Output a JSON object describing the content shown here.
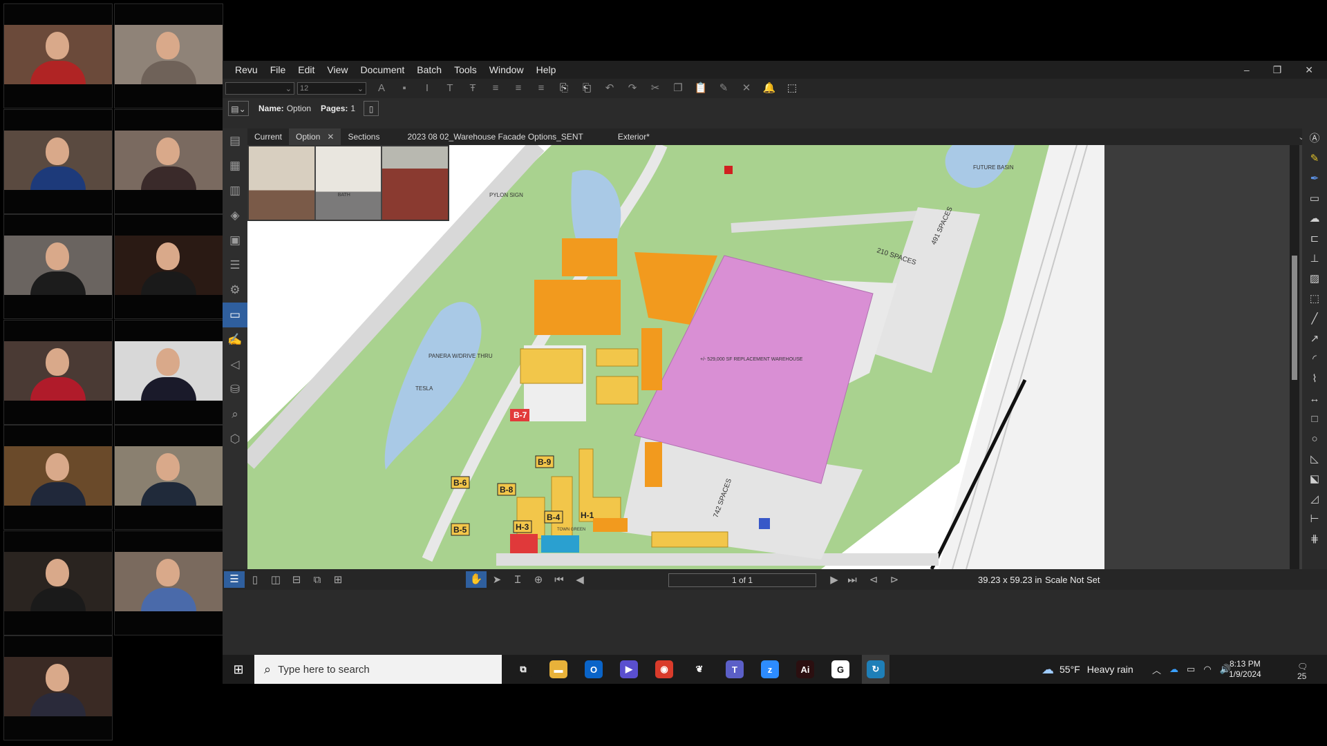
{
  "gallery": {
    "tiles": [
      {
        "bg": "#6b4a3a",
        "shirt": "#b02424"
      },
      {
        "bg": "#8f8378",
        "shirt": "#6f6259"
      },
      {
        "bg": "#5a4a40",
        "shirt": "#1d3a7a"
      },
      {
        "bg": "#7a6a60",
        "shirt": "#3a2a2a"
      },
      {
        "bg": "#6a6460",
        "shirt": "#1c1c1c"
      },
      {
        "bg": "#2a1a14",
        "shirt": "#1a1a1a"
      },
      {
        "bg": "#4a3a34",
        "shirt": "#b01b2a"
      },
      {
        "bg": "#d8d8d8",
        "shirt": "#1a1a2a"
      },
      {
        "bg": "#6a4a2a",
        "shirt": "#20283a"
      },
      {
        "bg": "#8a8070",
        "shirt": "#202a3a"
      },
      {
        "bg": "#2a2420",
        "shirt": "#1a1a1a"
      },
      {
        "bg": "#7a6a5e",
        "shirt": "#4a6aaa"
      },
      {
        "bg": "#3a2a24",
        "shirt": "#2a2a3a"
      }
    ]
  },
  "menu": {
    "items": [
      "Revu",
      "File",
      "Edit",
      "View",
      "Document",
      "Batch",
      "Tools",
      "Window",
      "Help"
    ],
    "window_controls": [
      "–",
      "❐",
      "✕"
    ]
  },
  "toolbar": {
    "font_name": "",
    "font_size": "12",
    "icons": [
      "font-color-icon",
      "trash-icon",
      "italic-icon",
      "text-icon",
      "text-strike-icon",
      "align-left-icon",
      "align-center-icon",
      "align-right-icon",
      "insert-page-icon",
      "extract-page-icon",
      "undo-icon",
      "redo-icon",
      "cut-icon",
      "copy-icon",
      "paste-icon",
      "format-painter-icon",
      "delete-icon",
      "lock-icon",
      "crop-icon"
    ]
  },
  "propbar": {
    "name_label": "Name:",
    "name_value": "Option",
    "pages_label": "Pages:",
    "pages_value": "1"
  },
  "tabs": {
    "items": [
      {
        "label": "Current",
        "active": false,
        "closable": false
      },
      {
        "label": "Option",
        "active": true,
        "closable": true
      },
      {
        "label": "Sections",
        "active": false,
        "closable": false
      },
      {
        "label": "2023 08 02_Warehouse Facade Options_SENT",
        "active": false,
        "closable": false
      },
      {
        "label": "Exterior*",
        "active": false,
        "closable": false
      }
    ]
  },
  "plan": {
    "labels": {
      "pylon": "PYLON SIGN",
      "future_basin": "FUTURE\nBASIN",
      "spaces_491": "491 SPACES",
      "spaces_210": "210 SPACES",
      "spaces_742": "742 SPACES",
      "warehouse": "+/- 529,000 SF\nREPLACEMENT\nWAREHOUSE",
      "tesla": "TESLA",
      "panera": "PANERA\nW/DRIVE THRU",
      "town_green": "TOWN\nGREEN"
    },
    "lots": [
      "B-7",
      "B-9",
      "B-6",
      "B-8",
      "B-4",
      "H-1",
      "H-3",
      "B-5"
    ],
    "facade_signs": [
      "",
      "",
      "BATH"
    ]
  },
  "statusbar": {
    "page_indicator": "1 of 1",
    "dimensions": "39.23 x 59.23 in",
    "scale": "Scale Not Set"
  },
  "taskbar": {
    "search_placeholder": "Type here to search",
    "apps": [
      {
        "name": "task-view-icon",
        "glyph": "⧉",
        "color": "#1c1c1c"
      },
      {
        "name": "file-explorer-icon",
        "glyph": "▬",
        "color": "#e8b23a"
      },
      {
        "name": "outlook-icon",
        "glyph": "O",
        "color": "#0a64c8"
      },
      {
        "name": "media-player-icon",
        "glyph": "▶",
        "color": "#5a4fcf"
      },
      {
        "name": "chrome-icon",
        "glyph": "◉",
        "color": "#d93b2b"
      },
      {
        "name": "app-icon",
        "glyph": "❦",
        "color": "#1c1c1c"
      },
      {
        "name": "teams-icon",
        "glyph": "T",
        "color": "#5b5fc7"
      },
      {
        "name": "zoom-icon",
        "glyph": "z",
        "color": "#2d8cff"
      },
      {
        "name": "acrobat-icon",
        "glyph": "Ai",
        "color": "#2b0f10"
      },
      {
        "name": "g-app-icon",
        "glyph": "G",
        "color": "#ffffff"
      },
      {
        "name": "bluebeam-icon",
        "glyph": "↻",
        "color": "#1e7fb8"
      }
    ],
    "weather_temp": "55°F",
    "weather_desc": "Heavy rain",
    "time": "8:13 PM",
    "date": "1/9/2024",
    "notification_count": "25"
  },
  "colors": {
    "accent": "#2f5f9e",
    "site_green": "#a9d28f",
    "warehouse": "#d98fd4",
    "building": "#f29a1e",
    "water": "#a9c9e6"
  }
}
